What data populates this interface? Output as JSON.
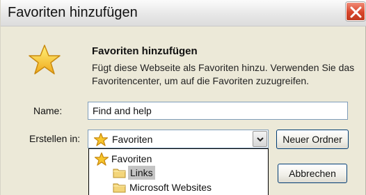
{
  "window": {
    "title": "Favoriten hinzufügen"
  },
  "header": {
    "title": "Favoriten hinzufügen",
    "description": "Fügt diese Webseite als Favoriten hinzu. Verwenden Sie das Favoritencenter, um auf die Favoriten zuzugreifen."
  },
  "form": {
    "name_label": "Name:",
    "name_value": "Find and help",
    "create_in_label": "Erstellen in:",
    "create_in_value": "Favoriten"
  },
  "buttons": {
    "new_folder": "Neuer Ordner",
    "cancel": "Abbrechen"
  },
  "dropdown": {
    "items": [
      {
        "label": "Favoriten",
        "icon": "star-icon"
      },
      {
        "label": "Links",
        "icon": "folder-icon",
        "selected": true
      },
      {
        "label": "Microsoft Websites",
        "icon": "folder-icon"
      }
    ]
  },
  "colors": {
    "dialog_bg": "#ece9d8",
    "close_button": "#d8462c",
    "selection": "#c4c4c4",
    "star": "#f7c62c"
  }
}
